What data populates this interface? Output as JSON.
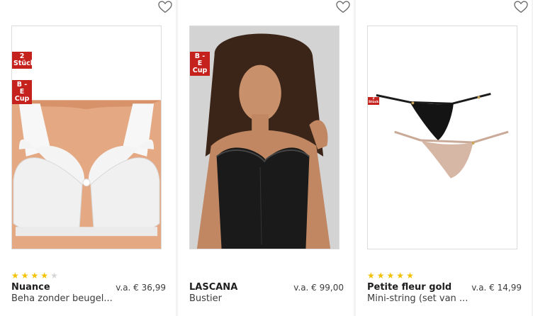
{
  "products": [
    {
      "badges": [
        "2 Stück",
        "B - E Cup"
      ],
      "rating_value": 4,
      "rating_max": 5,
      "brand": "Nuance",
      "price": "v.a. € 36,99",
      "subtitle": "Beha zonder beugel..."
    },
    {
      "badges": [
        "B - E Cup"
      ],
      "brand": "LASCANA",
      "price": "v.a. € 99,00",
      "subtitle": "Bustier"
    },
    {
      "badges": [
        "2 Stück"
      ],
      "rating_value": 5,
      "rating_max": 5,
      "brand": "Petite fleur gold",
      "price": "v.a. € 14,99",
      "subtitle": "Mini-string (set van ..."
    }
  ],
  "icons": {
    "wishlist": "heart-outline-icon",
    "rating": "star-icon"
  },
  "colors": {
    "badge": "#c5211d",
    "star_on": "#f2c200",
    "star_off": "#d6d6d6"
  }
}
